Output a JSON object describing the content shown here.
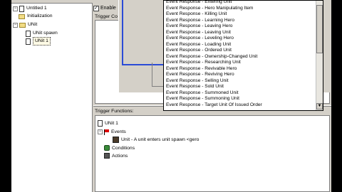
{
  "tree": {
    "map_name": "Untitled 1",
    "initialization": "Initialization",
    "category": "UNit",
    "trigger1": "UNit spawn",
    "trigger2": "UNit 1"
  },
  "trigger": {
    "enabled_label": "Enable",
    "comment_label": "Trigger Co",
    "functions_label": "Trigger Functions:",
    "root": "UNit 1",
    "events_label": "Events",
    "event_line": "Unit - A unit enters unit spawn <gero",
    "conditions_label": "Conditions",
    "actions_label": "Actions"
  },
  "dropdown": {
    "items": [
      "Event Response - Entering Unit",
      "Event Response - Hero Manipulating Item",
      "Event Response - Killing Unit",
      "Event Response - Learning Hero",
      "Event Response - Leaving Hero",
      "Event Response - Leaving Unit",
      "Event Response - Leveling Hero",
      "Event Response - Loading Unit",
      "Event Response - Ordered Unit",
      "Event Response - Ownership-Changed Unit",
      "Event Response - Researching Unit",
      "Event Response - Revivable Hero",
      "Event Response - Reviving Hero",
      "Event Response - Selling Unit",
      "Event Response - Sold Unit",
      "Event Response - Summoned Unit",
      "Event Response - Summoning Unit",
      "Event Response - Target Unit Of Issued Order"
    ]
  },
  "colors": {
    "dialog_border": "#2a4bd7",
    "window_face": "#d4d0c8"
  }
}
